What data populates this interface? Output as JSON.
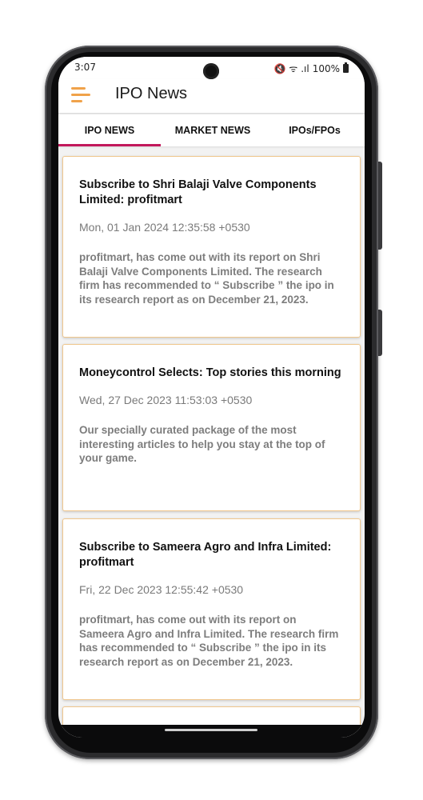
{
  "status_bar": {
    "time": "3:07",
    "indicators": "🔇 ᯤ .ıl",
    "battery": "100%"
  },
  "app_bar": {
    "title": "IPO News",
    "menu_icon": "hamburger-menu-icon",
    "accent_color": "#f0a24a"
  },
  "tabs": [
    {
      "label": "IPO NEWS",
      "active": true
    },
    {
      "label": "MARKET NEWS",
      "active": false
    },
    {
      "label": "IPOs/FPOs",
      "active": false
    }
  ],
  "tab_indicator_color": "#c2185b",
  "card_border_color": "#f0c78d",
  "articles": [
    {
      "title": "Subscribe to Shri Balaji Valve Components Limited: profitmart",
      "date": "Mon, 01 Jan 2024 12:35:58 +0530",
      "description": "profitmart, has come out with its report on Shri Balaji Valve Components Limited. The research firm has recommended to “ Subscribe ” the ipo in its research report as on December 21, 2023."
    },
    {
      "title": "Moneycontrol Selects: Top stories this morning",
      "date": "Wed, 27 Dec 2023 11:53:03 +0530",
      "description": "Our specially curated package of the most interesting articles to help you stay at the top of your game."
    },
    {
      "title": "Subscribe to Sameera Agro and Infra Limited: profitmart",
      "date": "Fri, 22 Dec 2023 12:55:42 +0530",
      "description": "profitmart, has come out with its report on Sameera Agro and Infra Limited. The research firm has recommended to “ Subscribe ” the ipo in its research report as on December 21, 2023."
    }
  ]
}
